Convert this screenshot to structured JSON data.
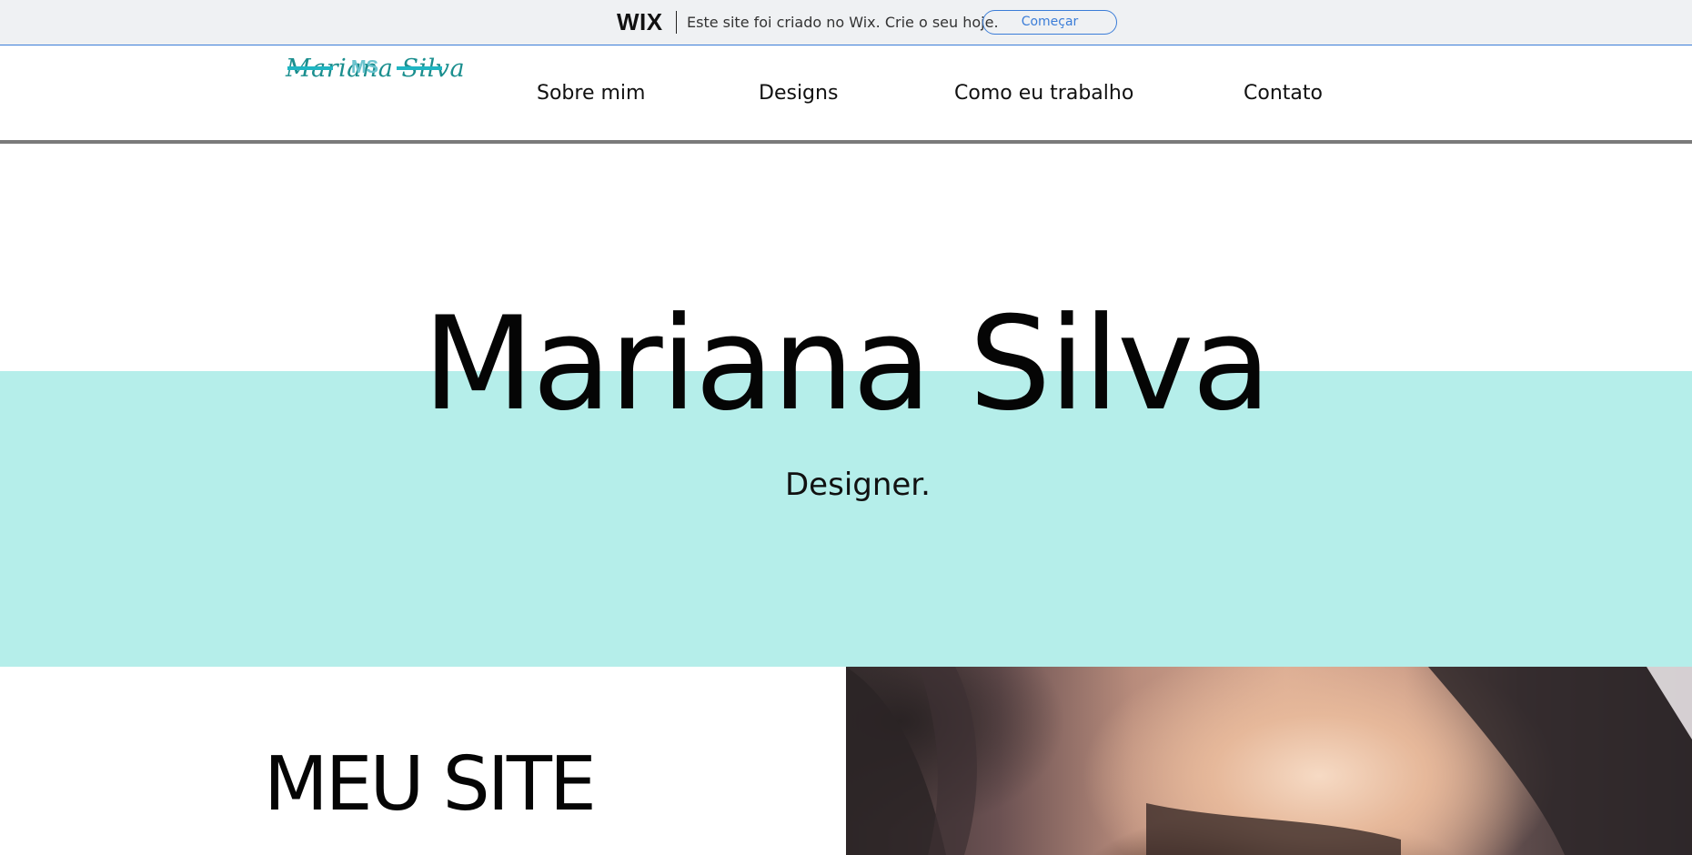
{
  "wix_banner": {
    "logo": "WIX",
    "message": "Este site foi criado no Wix. Crie o seu hoje.",
    "cta": "Começar",
    "accent": "#3b7dd8"
  },
  "header": {
    "logo_script": "Mariana Silva",
    "logo_mono": "MS",
    "nav": [
      "Sobre mim",
      "Designs",
      "Como eu trabalho",
      "Contato"
    ]
  },
  "hero": {
    "title": "Mariana Silva",
    "subtitle": "Designer.",
    "band_color": "#b5eeea"
  },
  "section": {
    "title": "MEU SITE"
  }
}
